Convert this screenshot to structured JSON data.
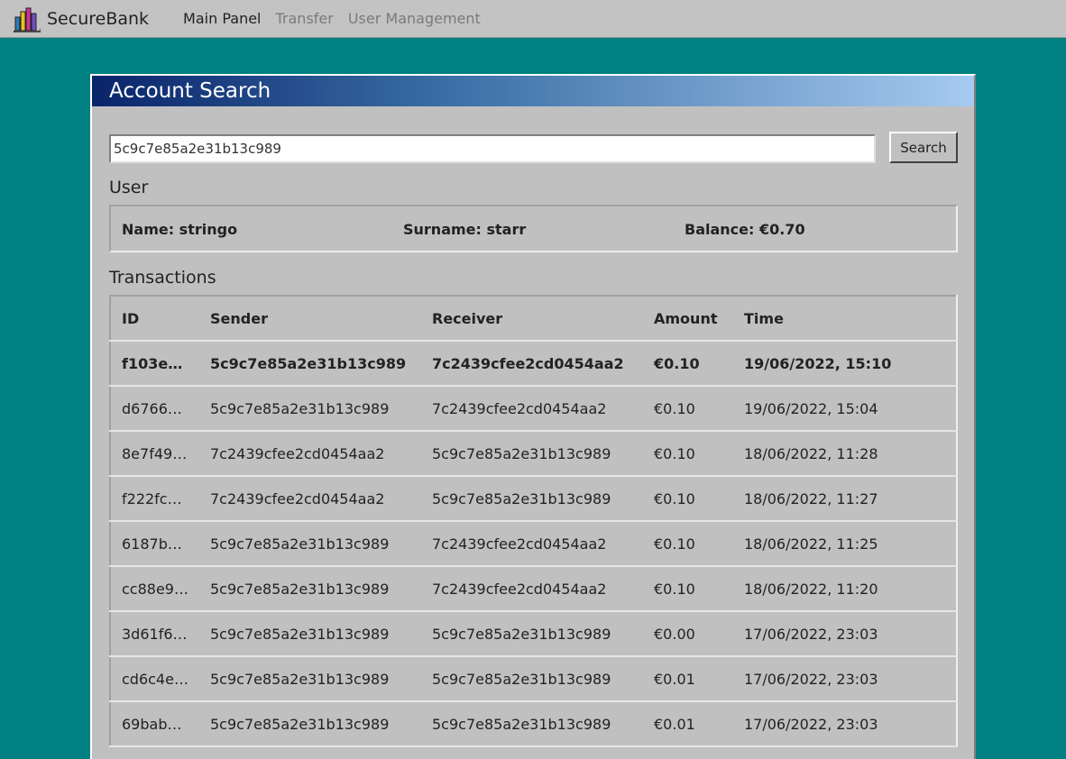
{
  "brand": {
    "name": "SecureBank",
    "icon": "bar-chart-icon"
  },
  "nav": {
    "items": [
      {
        "label": "Main Panel",
        "active": true
      },
      {
        "label": "Transfer",
        "active": false
      },
      {
        "label": "User Management",
        "active": false
      }
    ]
  },
  "window": {
    "title": "Account Search"
  },
  "search": {
    "value": "5c9c7e85a2e31b13c989",
    "button_label": "Search"
  },
  "user": {
    "heading": "User",
    "name_text": "Name: stringo",
    "surname_text": "Surname: starr",
    "balance_text": "Balance: €0.70"
  },
  "transactions": {
    "heading": "Transactions",
    "columns": [
      "ID",
      "Sender",
      "Receiver",
      "Amount",
      "Time"
    ],
    "rows": [
      [
        "f103e…",
        "5c9c7e85a2e31b13c989",
        "7c2439cfee2cd0454aa2",
        "€0.10",
        "19/06/2022, 15:10"
      ],
      [
        "d6766…",
        "5c9c7e85a2e31b13c989",
        "7c2439cfee2cd0454aa2",
        "€0.10",
        "19/06/2022, 15:04"
      ],
      [
        "8e7f49…",
        "7c2439cfee2cd0454aa2",
        "5c9c7e85a2e31b13c989",
        "€0.10",
        "18/06/2022, 11:28"
      ],
      [
        "f222fc…",
        "7c2439cfee2cd0454aa2",
        "5c9c7e85a2e31b13c989",
        "€0.10",
        "18/06/2022, 11:27"
      ],
      [
        "6187b…",
        "5c9c7e85a2e31b13c989",
        "7c2439cfee2cd0454aa2",
        "€0.10",
        "18/06/2022, 11:25"
      ],
      [
        "cc88e9…",
        "5c9c7e85a2e31b13c989",
        "7c2439cfee2cd0454aa2",
        "€0.10",
        "18/06/2022, 11:20"
      ],
      [
        "3d61f6…",
        "5c9c7e85a2e31b13c989",
        "5c9c7e85a2e31b13c989",
        "€0.00",
        "17/06/2022, 23:03"
      ],
      [
        "cd6c4e…",
        "5c9c7e85a2e31b13c989",
        "5c9c7e85a2e31b13c989",
        "€0.01",
        "17/06/2022, 23:03"
      ],
      [
        "69bab…",
        "5c9c7e85a2e31b13c989",
        "5c9c7e85a2e31b13c989",
        "€0.01",
        "17/06/2022, 23:03"
      ]
    ]
  }
}
